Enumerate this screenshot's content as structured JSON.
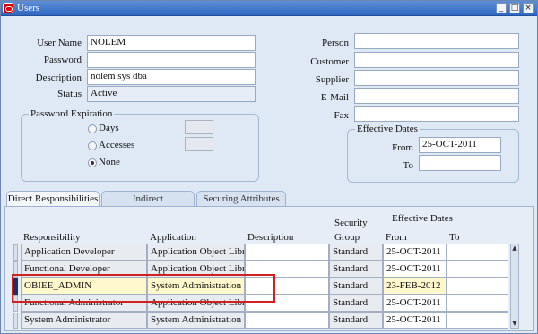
{
  "window": {
    "title": "Users",
    "buttons": [
      "_",
      "□",
      "×"
    ]
  },
  "user_form": {
    "user_name_label": "User Name",
    "user_name_value": "NOLEM",
    "password_label": "Password",
    "password_value": "",
    "description_label": "Description",
    "description_value": "nolem sys dba",
    "status_label": "Status",
    "status_value": "Active",
    "person_label": "Person",
    "customer_label": "Customer",
    "supplier_label": "Supplier",
    "email_label": "E-Mail",
    "fax_label": "Fax"
  },
  "password_expiration": {
    "title": "Password Expiration",
    "options": [
      "Days",
      "Accesses",
      "None"
    ],
    "selected": "None"
  },
  "effective_dates": {
    "title": "Effective Dates",
    "from_label": "From",
    "from_value": "25-OCT-2011",
    "to_label": "To",
    "to_value": ""
  },
  "tabs": [
    {
      "label": "Direct Responsibilities",
      "active": true
    },
    {
      "label": "Indirect Responsibilities",
      "active": false
    },
    {
      "label": "Securing Attributes",
      "active": false
    }
  ],
  "table": {
    "headers": {
      "responsibility": "Responsibility",
      "application": "Application",
      "description": "Description",
      "security_group_1": "Security",
      "security_group_2": "Group",
      "effective_dates": "Effective Dates",
      "from": "From",
      "to": "To"
    },
    "rows": [
      {
        "responsibility": "Application Developer",
        "application": "Application Object Library",
        "description": "",
        "group": "Standard",
        "from": "25-OCT-2011",
        "to": ""
      },
      {
        "responsibility": "Functional Developer",
        "application": "Application Object Library",
        "description": "",
        "group": "Standard",
        "from": "25-OCT-2011",
        "to": ""
      },
      {
        "responsibility": "OBIEE_ADMIN",
        "application": "System Administration",
        "description": "",
        "group": "Standard",
        "from": "23-FEB-2012",
        "to": ""
      },
      {
        "responsibility": "Functional Administrator",
        "application": "Application Object Library",
        "description": "",
        "group": "Standard",
        "from": "25-OCT-2011",
        "to": ""
      },
      {
        "responsibility": "System Administrator",
        "application": "System Administration",
        "description": "",
        "group": "Standard",
        "from": "25-OCT-2011",
        "to": ""
      }
    ],
    "current_row_index": 2
  },
  "colors": {
    "titlebar": "#2f67c3",
    "form_background": "#dfe9f5",
    "highlight_border": "#d02020",
    "selected_row_fill": "#fff8cc"
  }
}
